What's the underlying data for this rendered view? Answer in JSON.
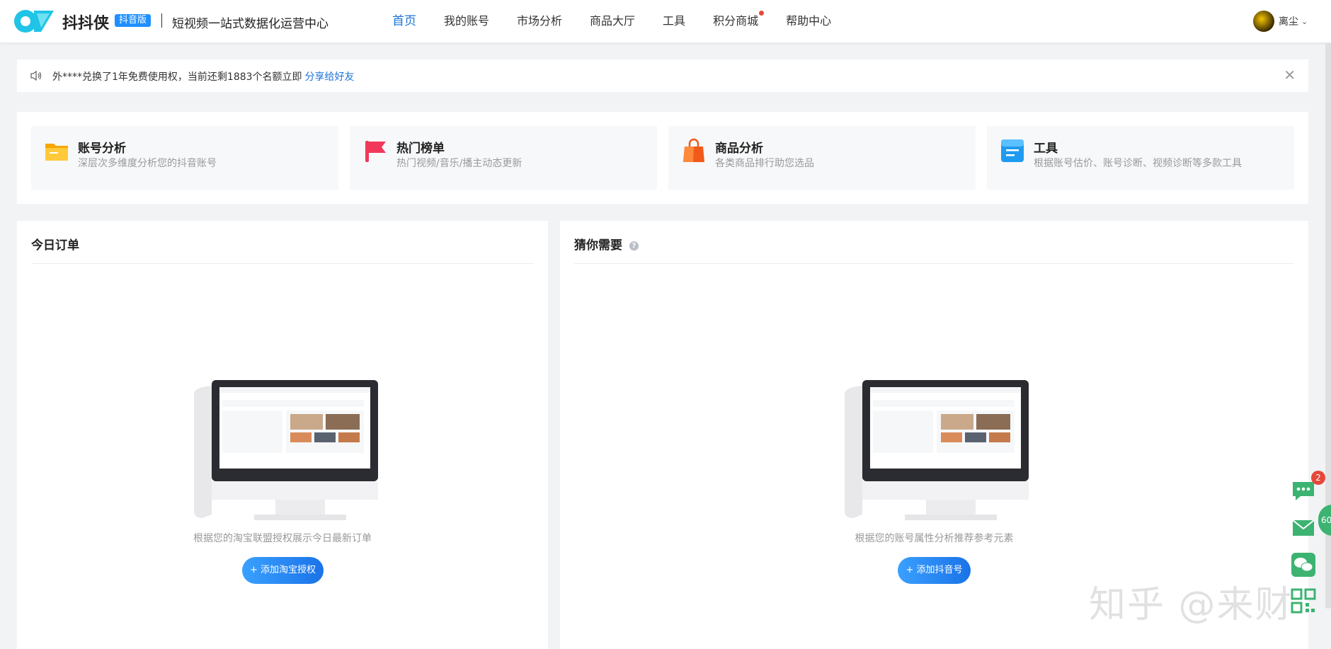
{
  "header": {
    "brand": "抖抖侠",
    "badge": "抖音版",
    "slogan": "短视频一站式数据化运营中心",
    "nav": [
      {
        "label": "首页",
        "active": true
      },
      {
        "label": "我的账号"
      },
      {
        "label": "市场分析"
      },
      {
        "label": "商品大厅"
      },
      {
        "label": "工具"
      },
      {
        "label": "积分商城",
        "dot": true
      },
      {
        "label": "帮助中心"
      }
    ],
    "user": {
      "name": "离尘"
    }
  },
  "notice": {
    "text": "外****兑换了1年免费使用权，当前还剩1883个名额立即",
    "link": "分享给好友",
    "close_icon": "close-icon"
  },
  "quick_cards": [
    {
      "title": "账号分析",
      "desc": "深层次多维度分析您的抖音账号",
      "icon": "folder-icon",
      "color": "#f7a600"
    },
    {
      "title": "热门榜单",
      "desc": "热门视频/音乐/播主动态更新",
      "icon": "flag-icon",
      "color": "#f2385a"
    },
    {
      "title": "商品分析",
      "desc": "各类商品排行助您选品",
      "icon": "shopping-bag-icon",
      "color": "#f05a1a"
    },
    {
      "title": "工具",
      "desc": "根据账号估价、账号诊断、视频诊断等多款工具",
      "icon": "tool-doc-icon",
      "color": "#1e9bf0"
    }
  ],
  "panels": {
    "orders": {
      "title": "今日订单",
      "empty_text": "根据您的淘宝联盟授权展示今日最新订单",
      "button": "+ 添加淘宝授权"
    },
    "guess": {
      "title": "猜你需要",
      "empty_text": "根据您的账号属性分析推荐参考元素",
      "button": "+ 添加抖音号"
    }
  },
  "floating": {
    "chat_badge": "2",
    "side_tab": "60"
  },
  "watermark": "知乎 @来财"
}
